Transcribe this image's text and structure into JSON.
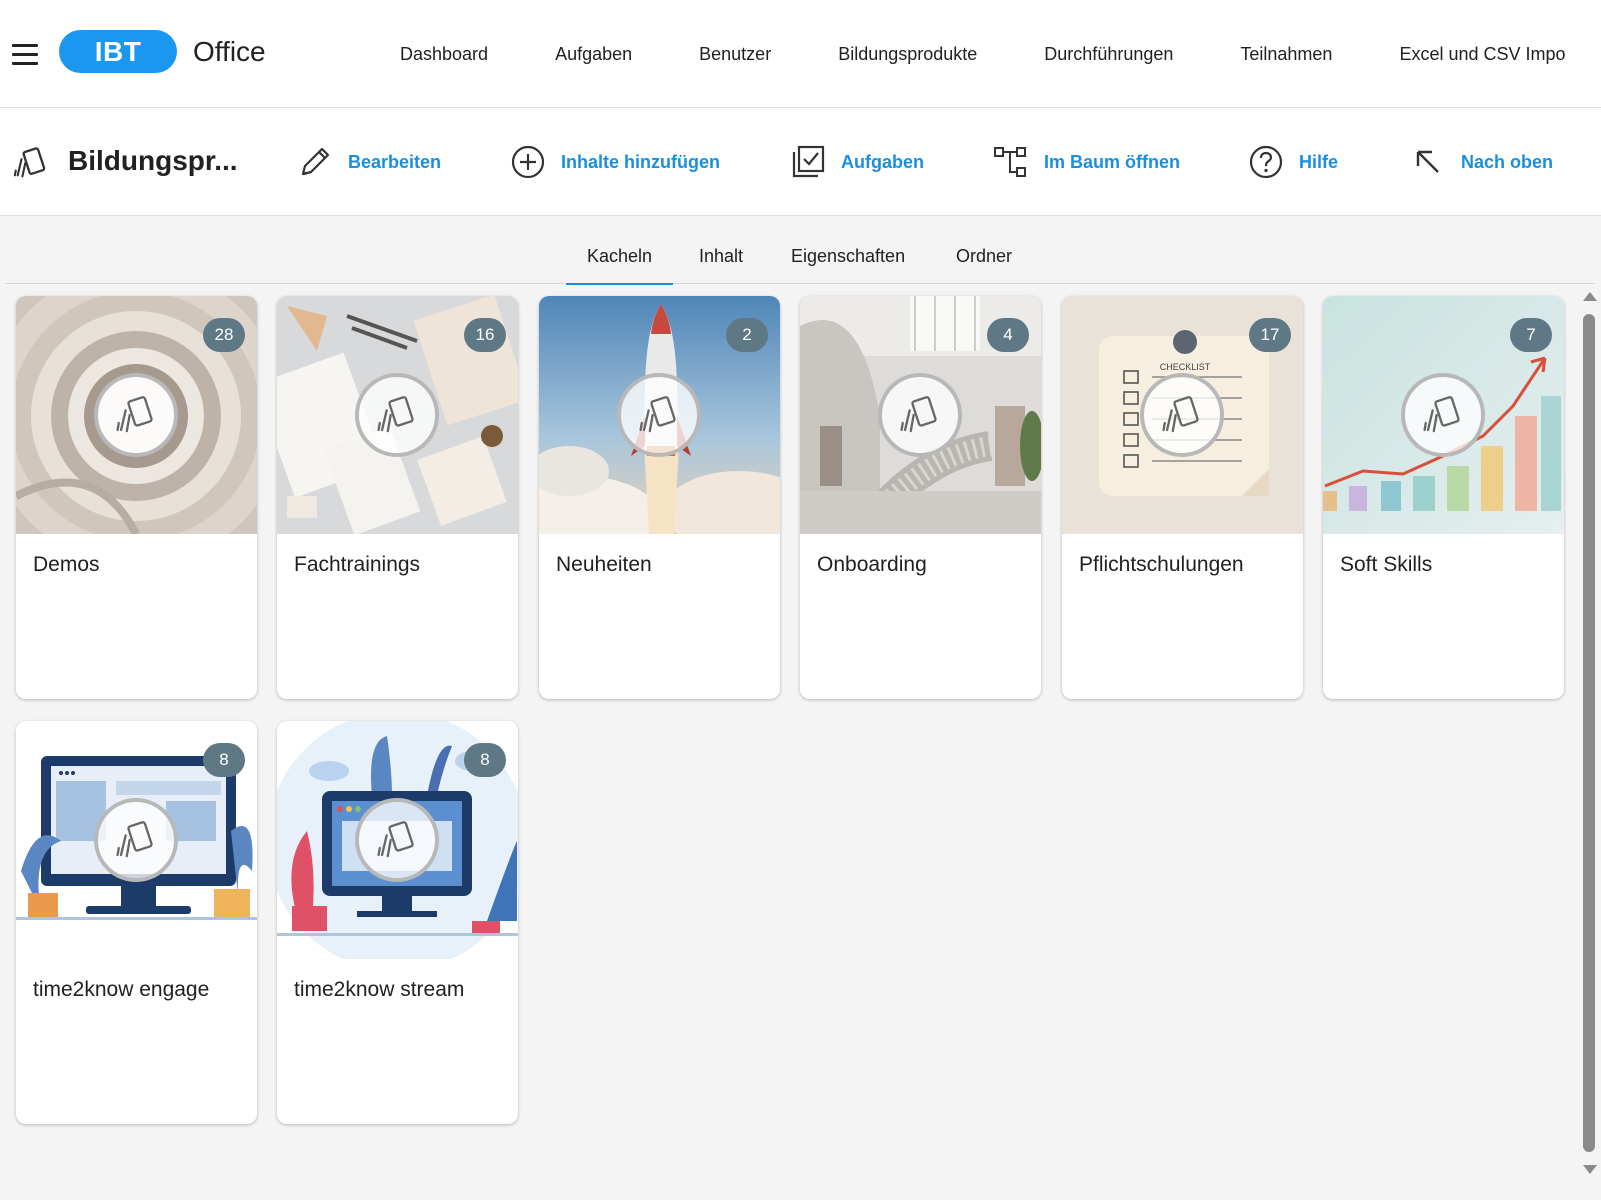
{
  "header": {
    "logo": "IBT",
    "app_name": "Office",
    "nav": [
      "Dashboard",
      "Aufgaben",
      "Benutzer",
      "Bildungsprodukte",
      "Durchführungen",
      "Teilnahmen",
      "Excel und CSV Impo"
    ]
  },
  "toolbar": {
    "title": "Bildungspr...",
    "actions": [
      {
        "label": "Bearbeiten",
        "icon": "pencil-icon"
      },
      {
        "label": "Inhalte hinzufügen",
        "icon": "plus-circle-icon"
      },
      {
        "label": "Aufgaben",
        "icon": "checklist-icon"
      },
      {
        "label": "Im Baum öffnen",
        "icon": "tree-icon"
      },
      {
        "label": "Hilfe",
        "icon": "help-icon"
      },
      {
        "label": "Nach oben",
        "icon": "arrow-up-left-icon"
      }
    ]
  },
  "tabs": [
    "Kacheln",
    "Inhalt",
    "Eigenschaften",
    "Ordner"
  ],
  "active_tab": "Kacheln",
  "tiles": [
    {
      "title": "Demos",
      "count": "28"
    },
    {
      "title": "Fachtrainings",
      "count": "16"
    },
    {
      "title": "Neuheiten",
      "count": "2"
    },
    {
      "title": "Onboarding",
      "count": "4"
    },
    {
      "title": "Pflichtschulungen",
      "count": "17"
    },
    {
      "title": "Soft Skills",
      "count": "7"
    },
    {
      "title": "time2know engage",
      "count": "8"
    },
    {
      "title": "time2know stream",
      "count": "8"
    }
  ],
  "tile_images": {
    "checklist_caption": "CHECKLIST"
  },
  "colors": {
    "accent": "#1a98f0",
    "link": "#1a8fe0",
    "badge": "#5f7885"
  }
}
